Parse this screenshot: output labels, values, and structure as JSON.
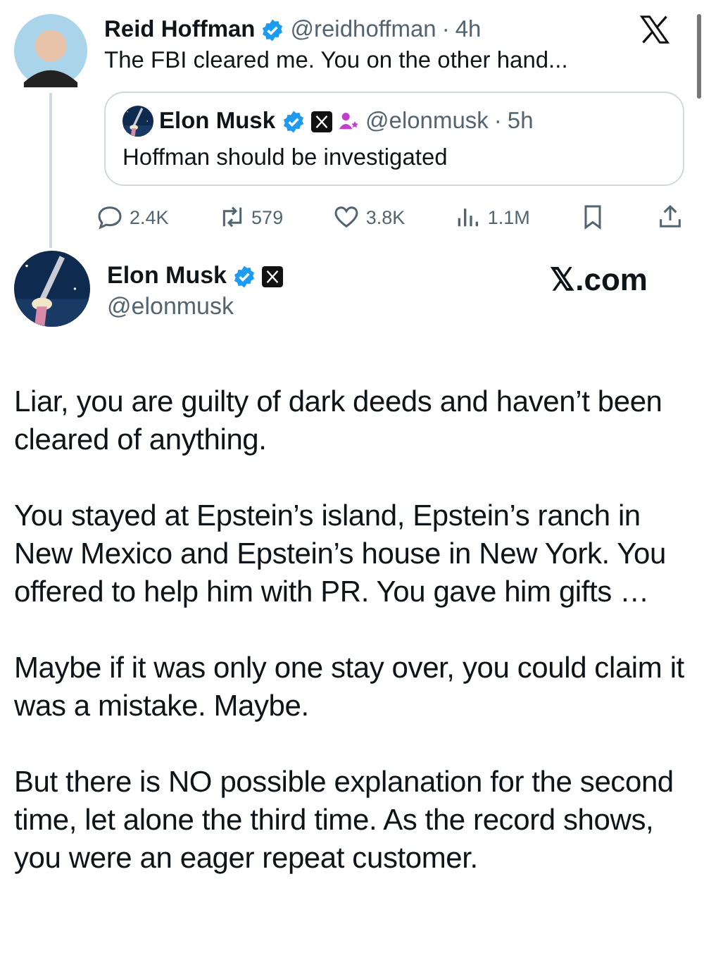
{
  "reply": {
    "name": "Reid Hoffman",
    "handle": "@reidhoffman",
    "separator": "·",
    "time": "4h",
    "text": "The FBI cleared me. You on the other hand...",
    "quote": {
      "name": "Elon Musk",
      "handle": "@elonmusk",
      "separator": "·",
      "time": "5h",
      "text": "Hoffman should be investigated"
    },
    "actions": [
      {
        "kind": "reply",
        "count": "2.4K"
      },
      {
        "kind": "repost",
        "count": "579"
      },
      {
        "kind": "like",
        "count": "3.8K"
      },
      {
        "kind": "views",
        "count": "1.1M"
      },
      {
        "kind": "bookmark"
      },
      {
        "kind": "share"
      }
    ]
  },
  "post": {
    "name": "Elon Musk",
    "handle": "@elonmusk",
    "site": "𝕏.com",
    "paragraphs": [
      "Liar, you are guilty of dark deeds and haven’t been cleared of anything.",
      "You stayed at Epstein’s island, Epstein’s ranch in New Mexico and Epstein’s house in New York. You offered to help him with PR. You gave him gifts …",
      "Maybe if it was only one stay over, you could claim it was a mistake. Maybe.",
      "But there is NO possible explanation for the second time, let alone the third time. As the record shows, you were an eager repeat customer."
    ]
  }
}
